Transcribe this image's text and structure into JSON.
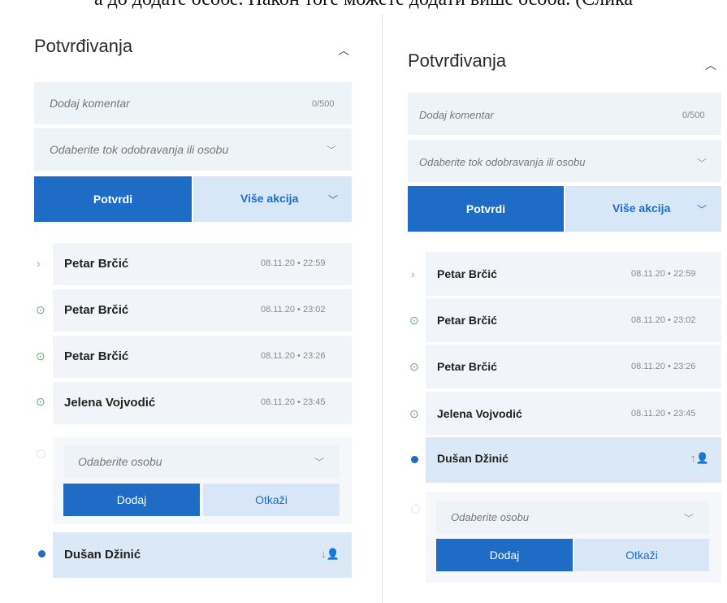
{
  "caption": "а до додате особе. Након тоге можете додати више особа. (Слика",
  "left": {
    "title": "Potvrđivanja",
    "comment_placeholder": "Dodaj komentar",
    "comment_counter": "0/500",
    "flow_select": "Odaberite tok odobravanja ili osobu",
    "confirm_button": "Potvrdi",
    "more_actions": "Više akcija",
    "rows": [
      {
        "name": "Petar Brčić",
        "time": "08.11.20 • 22:59"
      },
      {
        "name": "Petar Brčić",
        "time": "08.11.20 • 23:02"
      },
      {
        "name": "Petar Brčić",
        "time": "08.11.20 • 23:26"
      },
      {
        "name": "Jelena Vojvodić",
        "time": "08.11.20 • 23:45"
      }
    ],
    "person_select": "Odaberite osobu",
    "add_button": "Dodaj",
    "cancel_button": "Otkaži",
    "pending_person": "Dušan Džinić"
  },
  "right": {
    "title": "Potvrđivanja",
    "comment_placeholder": "Dodaj komentar",
    "comment_counter": "0/500",
    "flow_select": "Odaberite tok odobravanja ili osobu",
    "confirm_button": "Potvrdi",
    "more_actions": "Više akcija",
    "rows": [
      {
        "name": "Petar Brčić",
        "time": "08.11.20 • 22:59"
      },
      {
        "name": "Petar Brčić",
        "time": "08.11.20 • 23:02"
      },
      {
        "name": "Petar Brčić",
        "time": "08.11.20 • 23:26"
      },
      {
        "name": "Jelena Vojvodić",
        "time": "08.11.20 • 23:45"
      }
    ],
    "pending_person": "Dušan Džinić",
    "person_select": "Odaberite osobu",
    "add_button": "Dodaj",
    "cancel_button": "Otkaži"
  },
  "icons": {
    "collapse": "chevron-up-icon",
    "dropdown": "chevron-down-icon",
    "expand_row": "chevron-right-icon",
    "approved": "check-circle-icon",
    "person_move": "person-arrow-icon",
    "accent": "#1e6cc5"
  }
}
